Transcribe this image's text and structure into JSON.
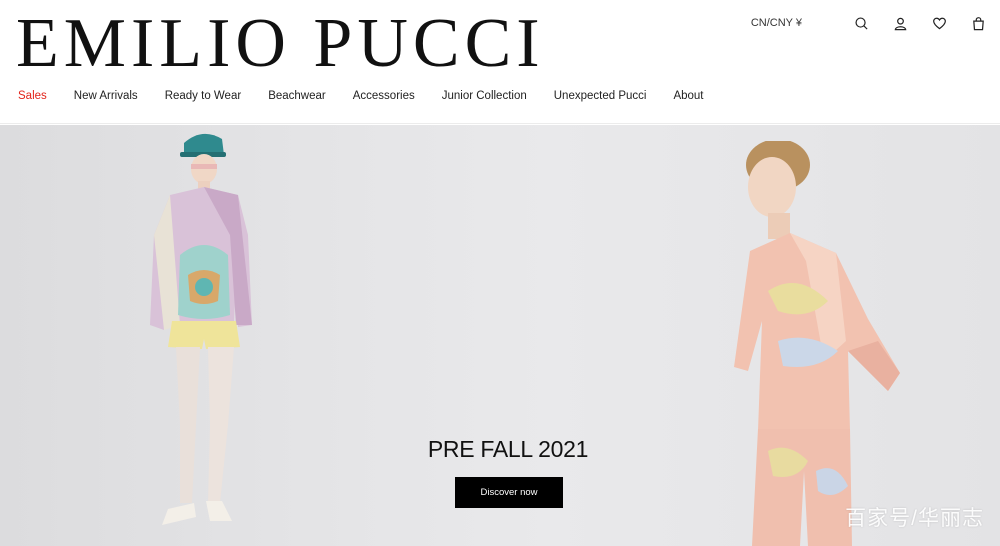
{
  "header": {
    "logo": "EMILIO PUCCI",
    "currency": "CN/CNY ¥",
    "icons": [
      "search-icon",
      "account-icon",
      "wishlist-icon",
      "bag-icon"
    ]
  },
  "nav": {
    "items": [
      {
        "label": "Sales"
      },
      {
        "label": "New Arrivals"
      },
      {
        "label": "Ready to Wear"
      },
      {
        "label": "Beachwear"
      },
      {
        "label": "Accessories"
      },
      {
        "label": "Junior Collection"
      },
      {
        "label": "Unexpected Pucci"
      },
      {
        "label": "About"
      }
    ]
  },
  "hero": {
    "title": "PRE FALL 2021",
    "button": "Discover now",
    "watermark": "百家号/华丽志"
  },
  "colors": {
    "sale": "#e2231a",
    "button_bg": "#000000",
    "hero_bg": "#e6e6e8"
  }
}
